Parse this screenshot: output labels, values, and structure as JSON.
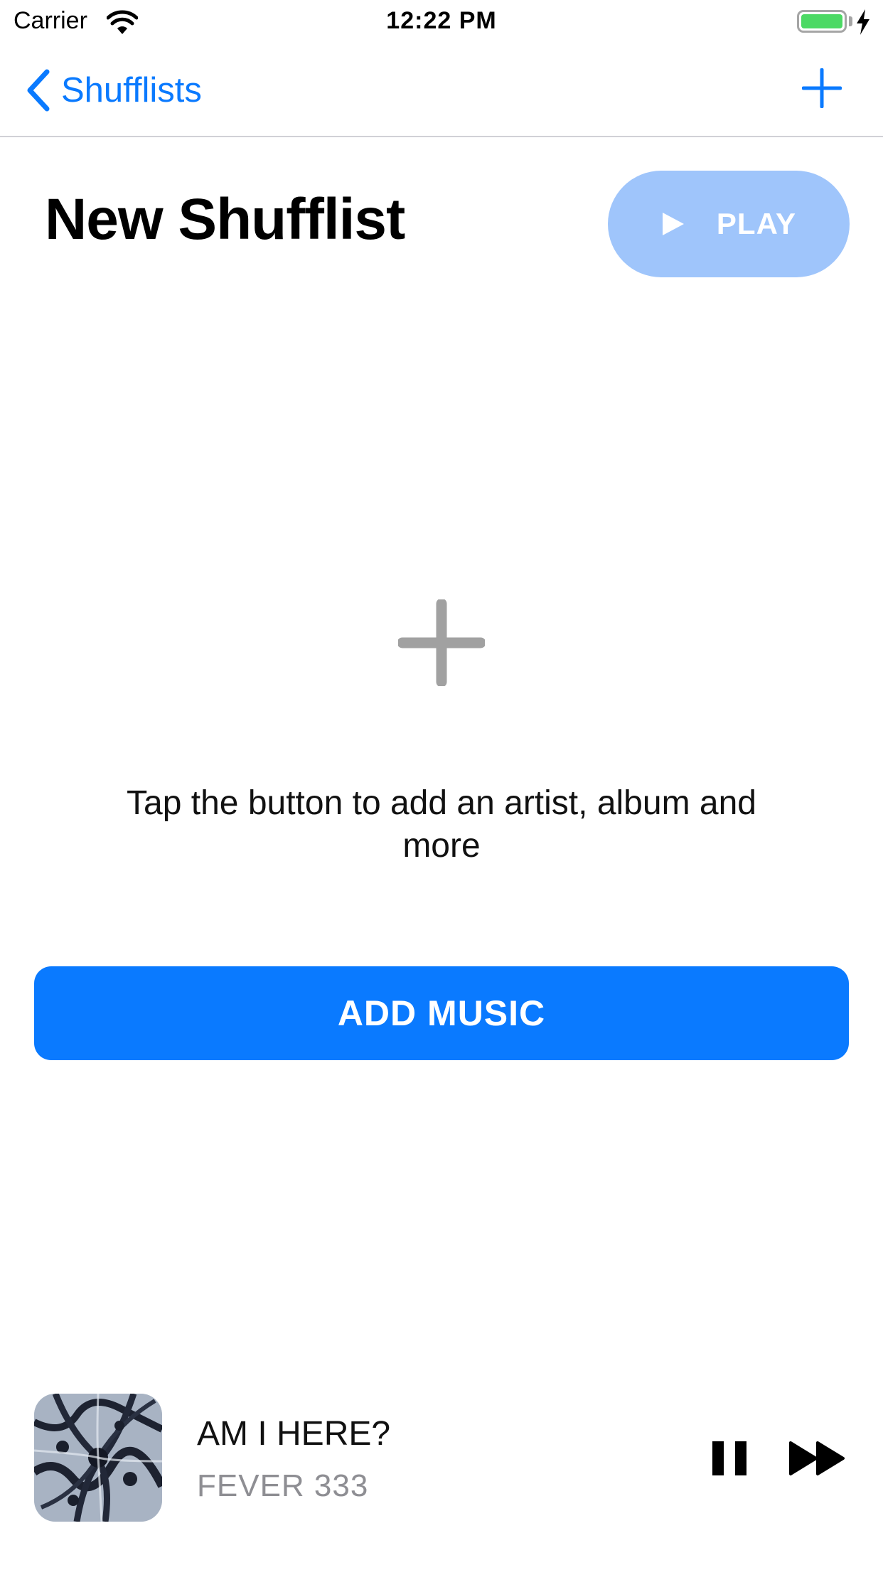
{
  "status_bar": {
    "carrier": "Carrier",
    "time": "12:22 PM",
    "battery_color": "#4cd964"
  },
  "nav": {
    "back_label": "Shufflists",
    "back_icon": "chevron-left-icon",
    "add_icon": "plus-icon",
    "accent": "#0a7aff"
  },
  "header": {
    "title": "New Shufflist",
    "play_label": "PLAY",
    "play_icon": "play-icon",
    "play_color": "#9fc5fb"
  },
  "empty_state": {
    "icon": "plus-icon",
    "message": "Tap the button to add an artist, album and more"
  },
  "add_music": {
    "label": "ADD MUSIC",
    "color": "#0a7aff"
  },
  "now_playing": {
    "title": "AM I HERE?",
    "artist": "FEVER 333",
    "pause_icon": "pause-icon",
    "skip_icon": "fast-forward-icon"
  }
}
